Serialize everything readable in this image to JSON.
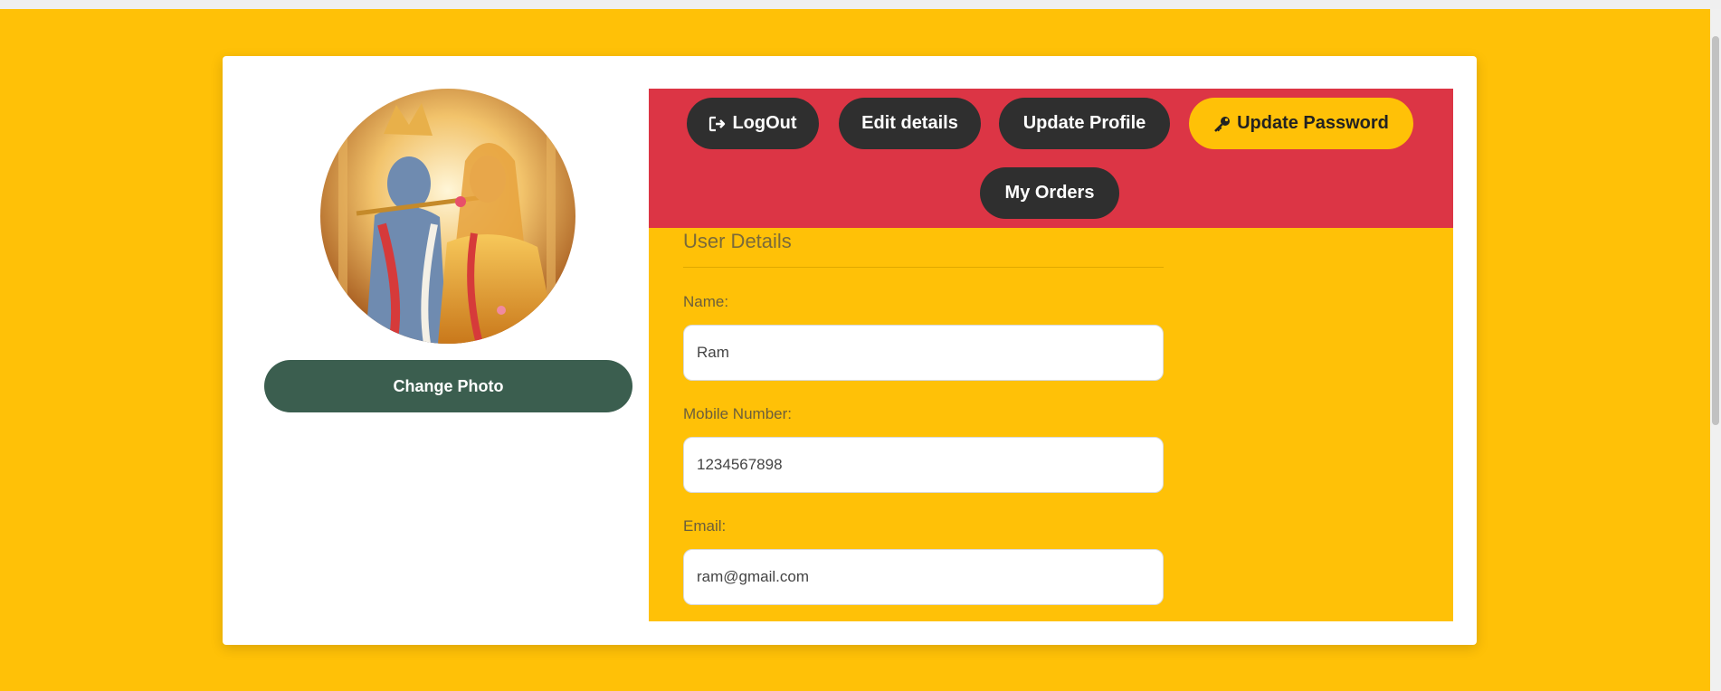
{
  "profile": {
    "change_photo_label": "Change Photo"
  },
  "nav": {
    "logout_label": "LogOut",
    "edit_details_label": "Edit details",
    "update_profile_label": "Update Profile",
    "update_password_label": "Update Password",
    "my_orders_label": "My Orders"
  },
  "details": {
    "title": "User Details",
    "name_label": "Name:",
    "name_value": "Ram",
    "mobile_label": "Mobile Number:",
    "mobile_value": "1234567898",
    "email_label": "Email:",
    "email_value": "ram@gmail.com"
  },
  "colors": {
    "page_bg": "#FFC107",
    "nav_band": "#DC3545",
    "pill_dark": "#2f2f2f",
    "change_photo": "#3B5E4F"
  },
  "icons": {
    "logout": "sign-out-icon",
    "password": "key-icon"
  }
}
